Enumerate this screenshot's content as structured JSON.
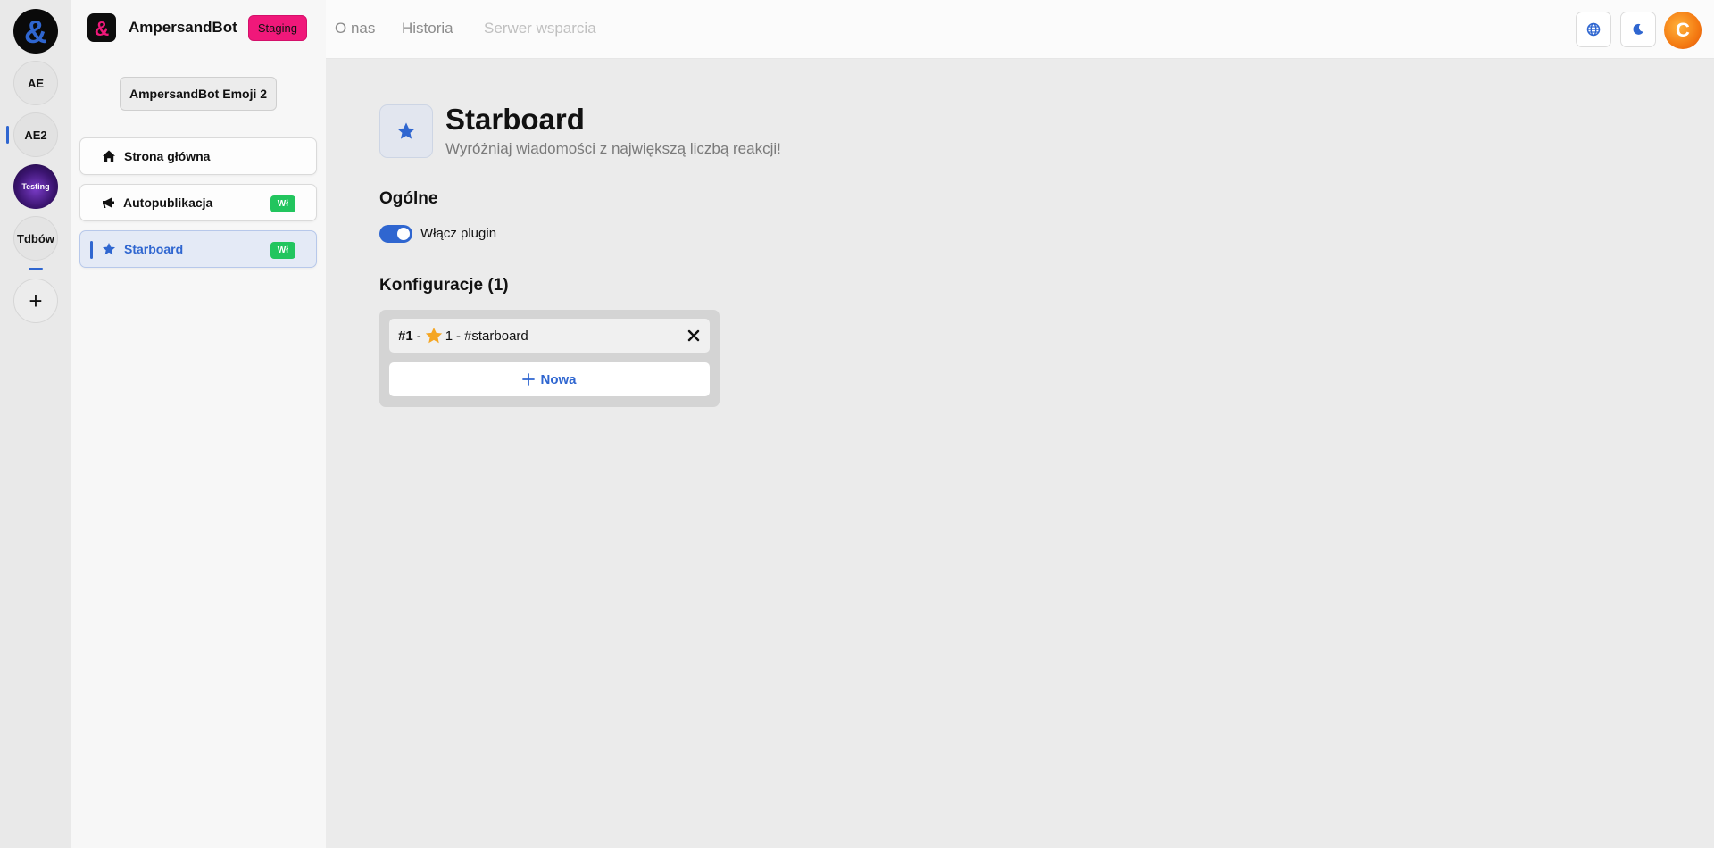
{
  "rail": {
    "items": [
      {
        "label": "AE"
      },
      {
        "label": "AE2"
      },
      {
        "label": "Testing"
      },
      {
        "label": "Tdbów"
      }
    ],
    "add_label": "+"
  },
  "sidebar": {
    "brand_name": "AmpersandBot",
    "env_badge": "Staging",
    "server_name": "AmpersandBot Emoji 2",
    "nav": [
      {
        "label": "Strona główna",
        "icon": "home-icon"
      },
      {
        "label": "Autopublikacja",
        "icon": "megaphone-icon",
        "badge": "Wł"
      },
      {
        "label": "Starboard",
        "icon": "star-icon",
        "badge": "Wł",
        "active": true
      }
    ]
  },
  "topbar": {
    "links": [
      "O nas",
      "Historia",
      "Serwer wsparcia"
    ],
    "avatar_letter": "C"
  },
  "main": {
    "title": "Starboard",
    "description": "Wyróżniaj wiadomości z największą liczbą reakcji!",
    "general_heading": "Ogólne",
    "enable_label": "Włącz plugin",
    "enabled": true,
    "configs_heading": "Konfiguracje (1)",
    "configs": [
      {
        "number": "#1",
        "count": "1",
        "channel": "#starboard"
      }
    ],
    "new_label": "Nowa"
  },
  "colors": {
    "accent": "#2f66d0",
    "staging_badge": "#f0187a",
    "on_badge": "#22c55e",
    "star": "#f5a623"
  }
}
